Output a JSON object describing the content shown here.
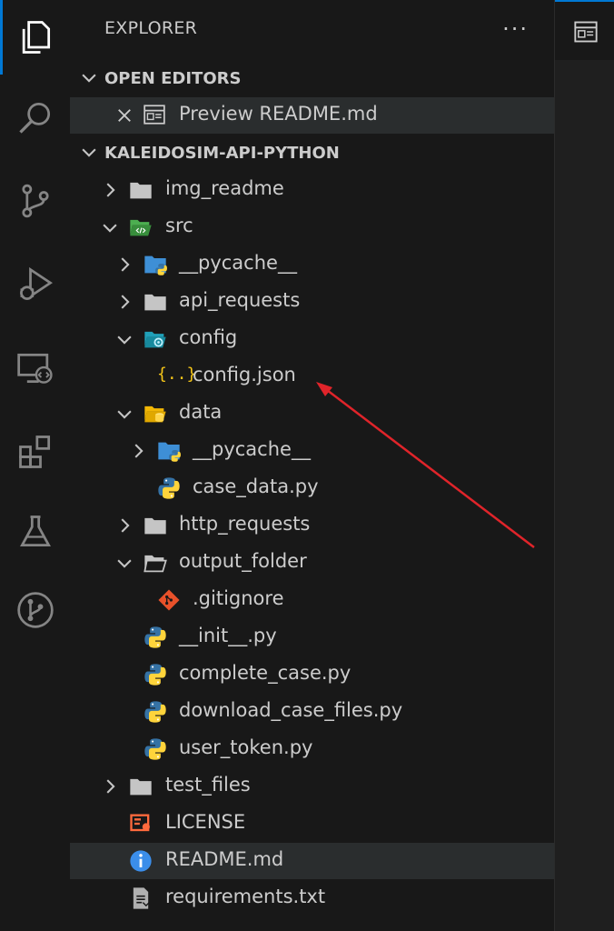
{
  "activity_bar": {
    "items": [
      {
        "icon": "files-icon"
      },
      {
        "icon": "search-icon"
      },
      {
        "icon": "source-control-icon"
      },
      {
        "icon": "run-debug-icon"
      },
      {
        "icon": "remote-explorer-icon"
      },
      {
        "icon": "extensions-icon"
      },
      {
        "icon": "testing-icon"
      },
      {
        "icon": "git-graph-icon"
      }
    ]
  },
  "sidebar": {
    "title": "EXPLORER",
    "more": "···",
    "open_editors": {
      "label": "OPEN EDITORS",
      "items": [
        {
          "name": "Preview README.md"
        }
      ]
    },
    "project": {
      "label": "KALEIDOSIM-API-PYTHON",
      "tree": [
        {
          "name": "img_readme"
        },
        {
          "name": "src"
        },
        {
          "name": "__pycache__"
        },
        {
          "name": "api_requests"
        },
        {
          "name": "config"
        },
        {
          "name": "config.json"
        },
        {
          "name": "data"
        },
        {
          "name": "__pycache__"
        },
        {
          "name": "case_data.py"
        },
        {
          "name": "http_requests"
        },
        {
          "name": "output_folder"
        },
        {
          "name": ".gitignore"
        },
        {
          "name": "__init__.py"
        },
        {
          "name": "complete_case.py"
        },
        {
          "name": "download_case_files.py"
        },
        {
          "name": "user_token.py"
        },
        {
          "name": "test_files"
        },
        {
          "name": "LICENSE"
        },
        {
          "name": "README.md"
        },
        {
          "name": "requirements.txt"
        }
      ]
    }
  },
  "colors": {
    "accent": "#0078d4",
    "arrow": "#e0242a",
    "folder": "#c5c5c5",
    "python_blue": "#3572A5",
    "python_yellow": "#FFD43B"
  }
}
